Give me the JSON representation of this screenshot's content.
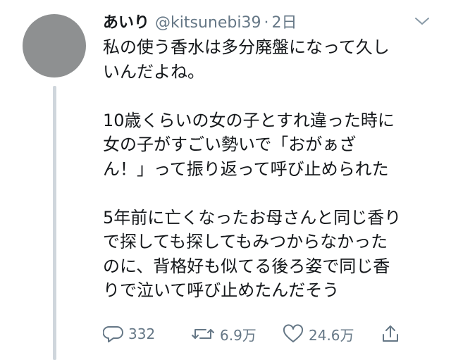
{
  "tweet": {
    "display_name": "あいり",
    "handle": "@kitsunebi39",
    "separator": "·",
    "timestamp": "2日",
    "lines": [
      "私の使う香水は多分廃盤になって久し",
      "いんだよね。",
      "",
      "10歳くらいの女の子とすれ違った時に",
      "女の子がすごい勢いで「おがぁざ",
      "ん！」って振り返って呼び止められた",
      "",
      "5年前に亡くなったお母さんと同じ香り",
      "で探しても探してもみつからなかった",
      "のに、背格好も似てる後ろ姿で同じ香",
      "りで泣いて呼び止めたんだそう"
    ],
    "actions": {
      "replies": "332",
      "retweets": "6.9万",
      "likes": "24.6万"
    }
  },
  "icons": [
    "caret-down-icon",
    "reply-icon",
    "retweet-icon",
    "like-icon",
    "share-icon"
  ],
  "colors": {
    "text": "#14171a",
    "secondary": "#657786",
    "thread_line": "#cfd6dc",
    "avatar": "#8e9091"
  }
}
